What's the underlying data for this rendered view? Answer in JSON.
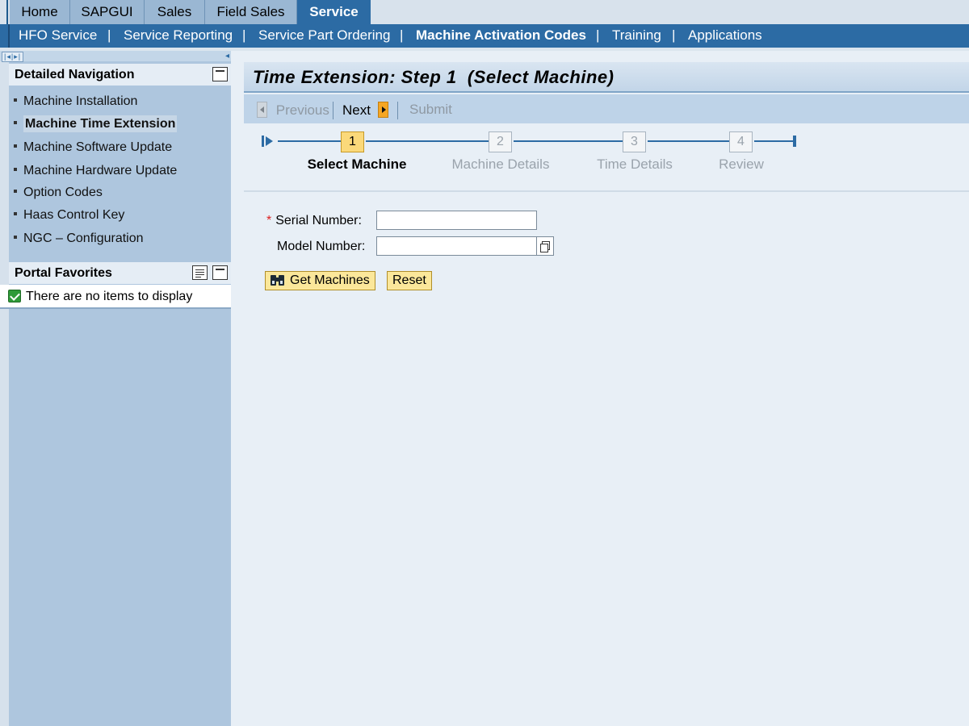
{
  "top_tabs": [
    {
      "label": "Home",
      "active": false
    },
    {
      "label": "SAPGUI",
      "active": false
    },
    {
      "label": "Sales",
      "active": false
    },
    {
      "label": "Field Sales",
      "active": false
    },
    {
      "label": "Service",
      "active": true
    }
  ],
  "sub_nav": [
    {
      "label": "HFO Service",
      "active": false
    },
    {
      "label": "Service Reporting",
      "active": false
    },
    {
      "label": "Service Part Ordering",
      "active": false
    },
    {
      "label": "Machine Activation Codes",
      "active": true
    },
    {
      "label": "Training",
      "active": false
    },
    {
      "label": "Applications",
      "active": false
    }
  ],
  "sub_nav_separator": "|",
  "detailed_navigation": {
    "title": "Detailed Navigation",
    "items": [
      {
        "label": "Machine Installation",
        "active": false
      },
      {
        "label": "Machine Time Extension",
        "active": true
      },
      {
        "label": "Machine Software Update",
        "active": false
      },
      {
        "label": "Machine Hardware Update",
        "active": false
      },
      {
        "label": "Option Codes",
        "active": false
      },
      {
        "label": "Haas Control Key",
        "active": false
      },
      {
        "label": "NGC – Configuration",
        "active": false
      }
    ]
  },
  "portal_favorites": {
    "title": "Portal Favorites",
    "empty_message": "There are no items to display"
  },
  "page": {
    "title": "Time Extension: Step 1  (Select Machine)"
  },
  "toolbar": {
    "previous_label": "Previous",
    "next_label": "Next",
    "submit_label": "Submit"
  },
  "wizard": {
    "steps": [
      {
        "number": "1",
        "label": "Select Machine",
        "active": true
      },
      {
        "number": "2",
        "label": "Machine Details",
        "active": false
      },
      {
        "number": "3",
        "label": "Time Details",
        "active": false
      },
      {
        "number": "4",
        "label": "Review",
        "active": false
      }
    ]
  },
  "form": {
    "required_marker": "*",
    "serial_number_label": "Serial Number:",
    "serial_number_value": "",
    "model_number_label": "Model Number:",
    "model_number_value": "",
    "get_machines_label": "Get Machines",
    "reset_label": "Reset"
  },
  "colors": {
    "nav_blue": "#2c6ba4",
    "tab_inactive": "#9ab7d3",
    "left_panel": "#aec6de",
    "active_step": "#fbd97a",
    "action_button": "#fbe79a"
  }
}
